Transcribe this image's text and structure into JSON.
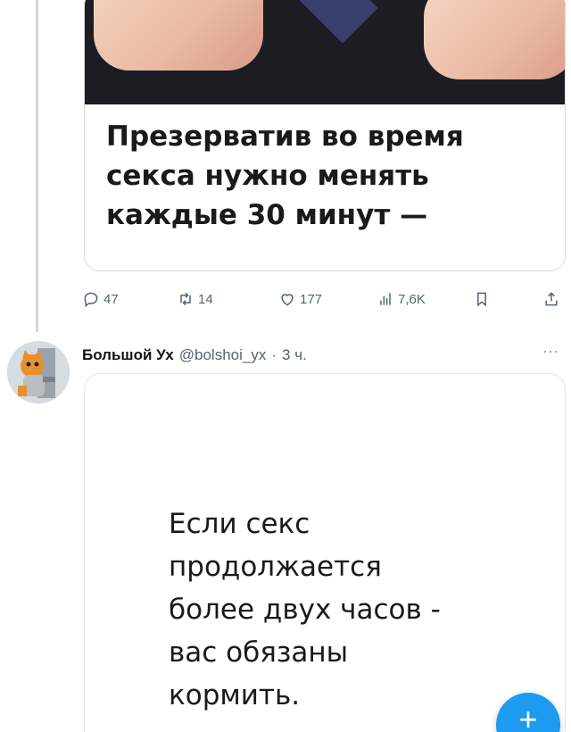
{
  "post1": {
    "card_text_lines": [
      "Презерватив во время",
      "секса нужно менять",
      "каждые 30 минут —"
    ],
    "stats": {
      "replies": "47",
      "reposts": "14",
      "likes": "177",
      "views": "7,6K"
    }
  },
  "post2": {
    "author_name": "Большой Ух",
    "author_handle": "@bolshoi_yx",
    "separator": "·",
    "time": "3 ч.",
    "more_label": "···",
    "card_text_lines": [
      "Если секс",
      "продолжается",
      "более двух часов -",
      "вас обязаны",
      "кормить."
    ]
  },
  "fab": {
    "label": "+"
  },
  "colors": {
    "accent": "#1d9bf0",
    "muted_text": "#536471",
    "thread_line": "#cfd9de"
  }
}
